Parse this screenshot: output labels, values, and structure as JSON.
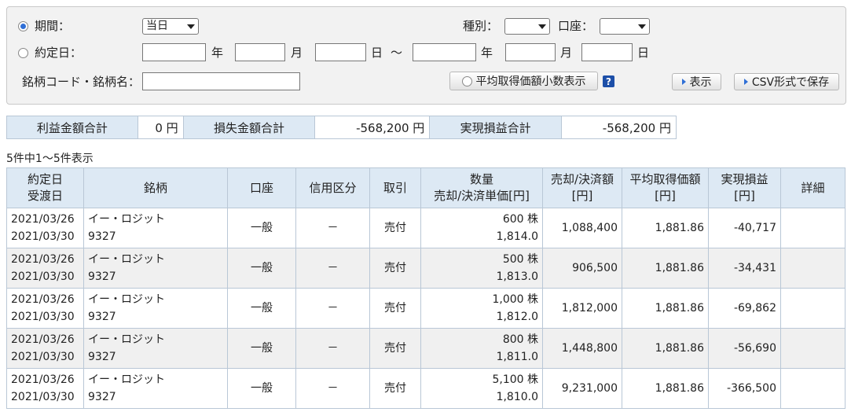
{
  "filter": {
    "period_label": "期間：",
    "period_option": "当日",
    "contract_label": "約定日：",
    "kind_label": "種別：",
    "kind_value": "",
    "account_label": "口座：",
    "account_value": "",
    "year": "年",
    "month": "月",
    "day": "日",
    "tilde": "～",
    "code_label": "銘柄コード・銘柄名：",
    "avg_btn": "平均取得価額小数表示",
    "help": "?",
    "show_btn": "表示",
    "csv_btn": "CSV形式で保存"
  },
  "summary": {
    "profit_label": "利益金額合計",
    "profit_value": "0 円",
    "loss_label": "損失金額合計",
    "loss_value": "-568,200 円",
    "realized_label": "実現損益合計",
    "realized_value": "-568,200 円"
  },
  "result_count": "5件中1～5件表示",
  "table": {
    "headers": {
      "date1": "約定日",
      "date2": "受渡日",
      "stock": "銘柄",
      "account": "口座",
      "margin": "信用区分",
      "trade": "取引",
      "qty1": "数量",
      "qty2": "売却/決済単価[円]",
      "amount1": "売却/決済額",
      "amount2": "[円]",
      "avg1": "平均取得価額",
      "avg2": "[円]",
      "pl1": "実現損益",
      "pl2": "[円]",
      "detail": "詳細"
    },
    "rows": [
      {
        "trade_date": "2021/03/26",
        "settle_date": "2021/03/30",
        "name": "イー・ロジット",
        "code": "9327",
        "account": "一般",
        "margin": "－",
        "trade": "売付",
        "qty": "600 株",
        "price": "1,814.0",
        "amount": "1,088,400",
        "avg": "1,881.86",
        "pl": "-40,717"
      },
      {
        "trade_date": "2021/03/26",
        "settle_date": "2021/03/30",
        "name": "イー・ロジット",
        "code": "9327",
        "account": "一般",
        "margin": "－",
        "trade": "売付",
        "qty": "500 株",
        "price": "1,813.0",
        "amount": "906,500",
        "avg": "1,881.86",
        "pl": "-34,431"
      },
      {
        "trade_date": "2021/03/26",
        "settle_date": "2021/03/30",
        "name": "イー・ロジット",
        "code": "9327",
        "account": "一般",
        "margin": "－",
        "trade": "売付",
        "qty": "1,000 株",
        "price": "1,812.0",
        "amount": "1,812,000",
        "avg": "1,881.86",
        "pl": "-69,862"
      },
      {
        "trade_date": "2021/03/26",
        "settle_date": "2021/03/30",
        "name": "イー・ロジット",
        "code": "9327",
        "account": "一般",
        "margin": "－",
        "trade": "売付",
        "qty": "800 株",
        "price": "1,811.0",
        "amount": "1,448,800",
        "avg": "1,881.86",
        "pl": "-56,690"
      },
      {
        "trade_date": "2021/03/26",
        "settle_date": "2021/03/30",
        "name": "イー・ロジット",
        "code": "9327",
        "account": "一般",
        "margin": "－",
        "trade": "売付",
        "qty": "5,100 株",
        "price": "1,810.0",
        "amount": "9,231,000",
        "avg": "1,881.86",
        "pl": "-366,500"
      }
    ]
  },
  "colors": {
    "header_bg": "#dde9f4",
    "border": "#b9c7d6",
    "radio_selected": "#2f6fd6",
    "help_bg": "#1d4fa8"
  }
}
